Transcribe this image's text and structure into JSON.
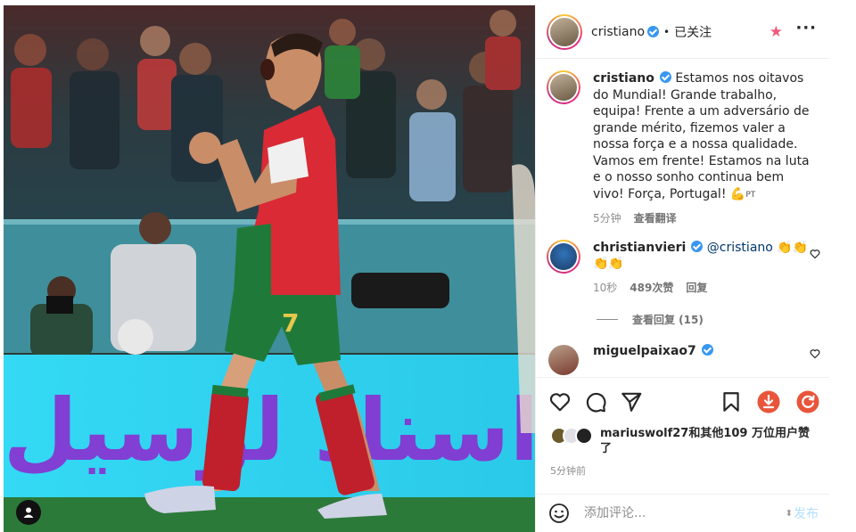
{
  "post": {
    "author": "cristiano",
    "follow_status": "已关注",
    "caption": "Estamos nos oitavos do Mundial! Grande trabalho, equipa! Frente a um adversário de grande mérito, fizemos valer a nossa força e a nossa qualidade. Vamos em frente! Estamos na luta e o nosso sonho continua bem vivo! Força, Portugal! 💪",
    "caption_lang": "PT",
    "caption_time": "5分钟",
    "see_translation": "查看翻译",
    "photo": {
      "billboard_text": "اسناد لوسيل",
      "jersey_number": "7"
    }
  },
  "comments": [
    {
      "username": "christianvieri",
      "mention": "@cristiano",
      "emoji": "👏👏👏👏",
      "time": "10秒",
      "likes": "489次赞",
      "reply": "回复",
      "view_replies": "查看回复 (15)"
    },
    {
      "username": "miguelpaixao7"
    }
  ],
  "likes": {
    "text": "mariuswolf27和其他109 万位用户赞了"
  },
  "post_time": "5分钟前",
  "composer": {
    "placeholder": "添加评论...",
    "post_label": "发布"
  },
  "icons": {
    "header": [
      "verified-badge-icon",
      "star-icon",
      "more-icon"
    ],
    "actions": [
      "heart-icon",
      "comment-icon",
      "share-icon",
      "bookmark-icon",
      "download-icon",
      "refresh-icon"
    ],
    "composer": [
      "emoji-icon"
    ],
    "photo": [
      "user-tag-icon"
    ]
  },
  "colors": {
    "verified": "#3897f0",
    "link": "#00376b",
    "muted": "#8e8e8e",
    "star": "#ef5a7a",
    "download_button": "#e8553a",
    "post_button_disabled": "#b2dffc",
    "billboard": "#2fd6f2",
    "billboard_text": "#8a2fd0",
    "jersey_red": "#d92a35",
    "shorts_green": "#1f7a3a"
  }
}
